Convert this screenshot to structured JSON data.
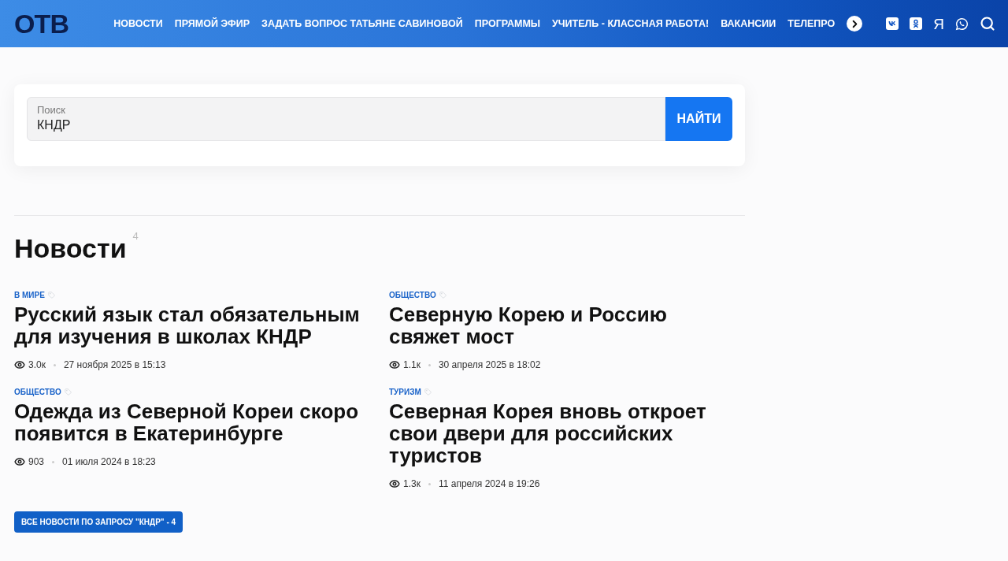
{
  "header": {
    "logo": "ОТВ",
    "nav": [
      "НОВОСТИ",
      "ПРЯМОЙ ЭФИР",
      "ЗАДАТЬ ВОПРОС ТАТЬЯНЕ САВИНОВОЙ",
      "ПРОГРАММЫ",
      "УЧИТЕЛЬ - КЛАССНАЯ РАБОТА!",
      "ВАКАНСИИ",
      "ТЕЛЕПРО"
    ],
    "social": [
      {
        "kind": "vk"
      },
      {
        "kind": "ok"
      },
      {
        "kind": "letter",
        "text": "Я"
      },
      {
        "kind": "whatsapp"
      },
      {
        "kind": "search"
      }
    ]
  },
  "search": {
    "label": "Поиск",
    "value": "КНДР",
    "button": "НАЙТИ"
  },
  "section": {
    "title": "Новости",
    "count": "4"
  },
  "articles": [
    {
      "category": "В МИРЕ",
      "title": "Русский язык стал обязательным для изучения в школах КНДР",
      "views": "3.0к",
      "date": "27 ноября 2025 в 15:13"
    },
    {
      "category": "ОБЩЕСТВО",
      "title": "Северную Корею и Россию свяжет мост",
      "views": "1.1к",
      "date": "30 апреля 2025 в 18:02"
    },
    {
      "category": "ОБЩЕСТВО",
      "title": "Одежда из Северной Кореи скоро появится в Екатеринбурге",
      "views": "903",
      "date": "01 июля 2024 в 18:23"
    },
    {
      "category": "ТУРИЗМ",
      "title": "Северная Корея вновь откроет свои двери для российских туристов",
      "views": "1.3к",
      "date": "11 апреля 2024 в 19:26"
    }
  ],
  "all_button": "ВСЕ НОВОСТИ ПО ЗАПРОСУ \"КНДР\" - 4"
}
